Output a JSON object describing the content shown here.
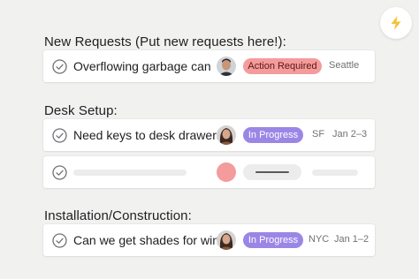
{
  "colors": {
    "background": "#f1f1f0",
    "action_required": "#f49b9b",
    "in_progress": "#9b86e6",
    "bolt": "#f6c234",
    "placeholder_avatar": "#f49b9b"
  },
  "toolbar": {
    "rules_icon": "lightning-bolt-icon"
  },
  "sections": [
    {
      "title": "New Requests (Put new requests here!):",
      "tasks": [
        {
          "name": "Overflowing garbage can",
          "status": "Action Required",
          "location": "Seattle",
          "date": ""
        }
      ]
    },
    {
      "title": "Desk Setup:",
      "tasks": [
        {
          "name": "Need keys to desk drawers",
          "status": "In Progress",
          "location": "SF",
          "date": "Jan 2–3"
        }
      ]
    },
    {
      "title": "Installation/Construction:",
      "tasks": [
        {
          "name": "Can we get shades for win...",
          "status": "In Progress",
          "location": "NYC",
          "date": "Jan 1–2"
        }
      ]
    }
  ]
}
